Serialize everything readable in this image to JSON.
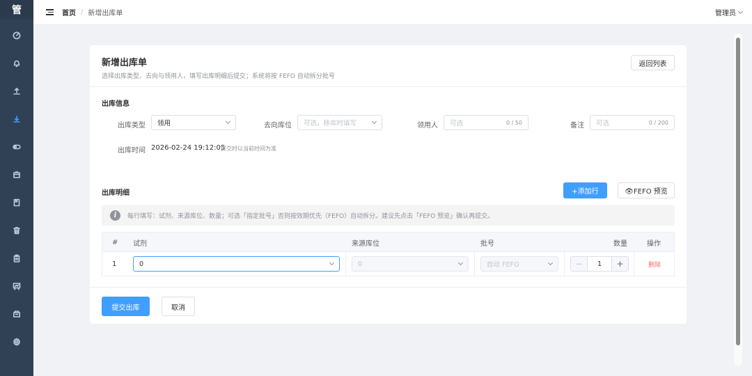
{
  "sidebar": {
    "logo": "管",
    "items": [
      {
        "icon": "dashboard-icon"
      },
      {
        "icon": "bell-icon"
      },
      {
        "icon": "upload-icon"
      },
      {
        "icon": "download-icon",
        "active": true
      },
      {
        "icon": "toggle-icon"
      },
      {
        "icon": "box-icon"
      },
      {
        "icon": "book-icon"
      },
      {
        "icon": "trash-icon"
      },
      {
        "icon": "clipboard-icon"
      },
      {
        "icon": "board-icon"
      },
      {
        "icon": "archive-icon"
      },
      {
        "icon": "gear-icon"
      }
    ]
  },
  "topbar": {
    "breadcrumb_home": "首页",
    "breadcrumb_sep": "/",
    "breadcrumb_current": "新增出库单",
    "user": "管理员"
  },
  "card": {
    "title": "新增出库单",
    "subtitle": "选择出库类型、去向与领用人，填写出库明细后提交；系统将按 FEFO 自动拆分批号",
    "back_label": "返回列表"
  },
  "info": {
    "section_title": "出库信息",
    "type_label": "出库类型",
    "type_value": "领用",
    "dest_label": "去向库位",
    "dest_placeholder": "可选，移库时填写",
    "receiver_label": "领用人",
    "receiver_placeholder": "可选",
    "receiver_count": "0 / 50",
    "remark_label": "备注",
    "remark_placeholder": "可选",
    "remark_count": "0 / 200",
    "time_label": "出库时间",
    "time_value": "2026-02-24 19:12:05",
    "time_hint": "提交时以当前时间为准"
  },
  "detail": {
    "section_title": "出库明细",
    "add_row_label": "+添加行",
    "fefo_preview_label": "👁FEFO 预览",
    "alert_text": "每行填写：试剂、来源库位、数量；可选「指定批号」否则按效期优先（FEFO）自动拆分。建议先点击「FEFO 预览」确认再提交。",
    "columns": {
      "index": "#",
      "reagent": "试剂",
      "source": "来源库位",
      "batch": "批号",
      "qty": "数量",
      "ops": "操作"
    },
    "rows": [
      {
        "index": "1",
        "reagent": "0",
        "source": "0",
        "batch": "自动 FEFO",
        "qty": "1",
        "delete": "删除"
      }
    ]
  },
  "footer": {
    "submit_label": "提交出库",
    "cancel_label": "取消"
  },
  "colors": {
    "primary": "#409eff",
    "sidebar": "#304156",
    "danger": "#f56c6c"
  }
}
